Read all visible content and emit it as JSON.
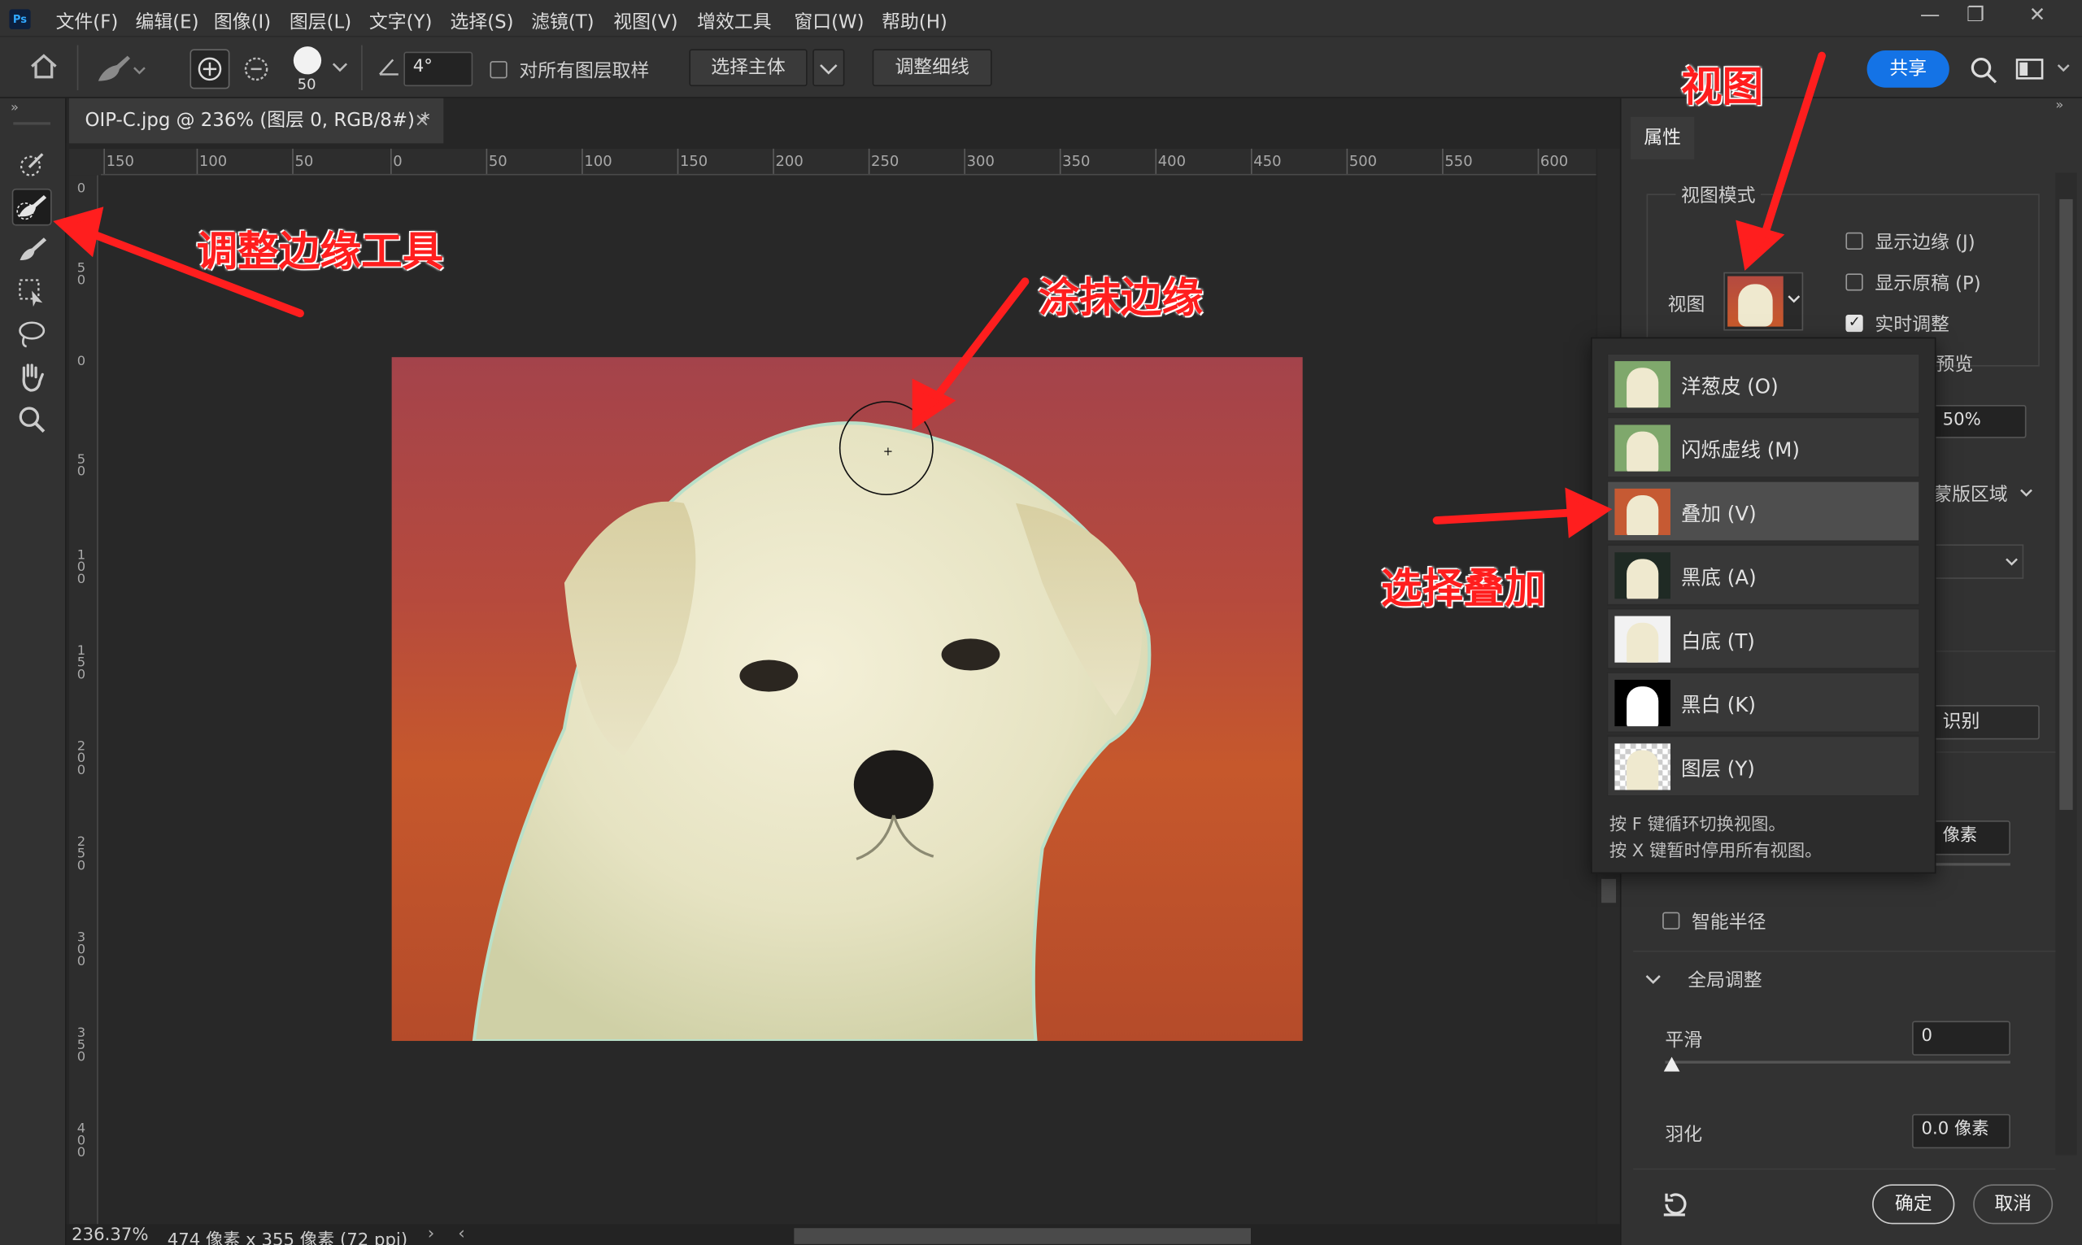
{
  "app": {
    "logo": "Ps"
  },
  "menu": [
    "文件(F)",
    "编辑(E)",
    "图像(I)",
    "图层(L)",
    "文字(Y)",
    "选择(S)",
    "滤镜(T)",
    "视图(V)",
    "增效工具",
    "窗口(W)",
    "帮助(H)"
  ],
  "window_controls": {
    "minimize": "—",
    "restore": "❐",
    "close": "✕"
  },
  "options": {
    "brush_size": "50",
    "angle": "4°",
    "sample_all_layers_label": "对所有图层取样",
    "select_subject_label": "选择主体",
    "refine_hair_label": "调整细线",
    "share_label": "共享"
  },
  "document": {
    "tab_title": "OIP-C.jpg @ 236% (图层 0, RGB/8#) *",
    "close_glyph": "×"
  },
  "ruler_h": [
    "150",
    "100",
    "50",
    "0",
    "50",
    "100",
    "150",
    "200",
    "250",
    "300",
    "350",
    "400",
    "450",
    "500",
    "550",
    "600"
  ],
  "ruler_v": [
    "0",
    "5 0",
    "0",
    "5 0",
    "1 0 0",
    "1 5 0",
    "2 0 0",
    "2 5 0",
    "3 0 0",
    "3 5 0",
    "4 0 0"
  ],
  "status": {
    "zoom": "236.37%",
    "dims": "474 像素 x 355 像素 (72 ppi)"
  },
  "properties": {
    "tab_label": "属性",
    "view_mode_label": "视图模式",
    "view_label": "视图",
    "show_edge": {
      "label": "显示边缘 (J)",
      "checked": false
    },
    "show_original": {
      "label": "显示原稿 (P)",
      "checked": false
    },
    "realtime": {
      "label": "实时调整",
      "checked": true
    },
    "preview_partial": "预览",
    "opacity_partial": "50%",
    "mask_partial": "蒙版区域",
    "detect_partial": "识别",
    "pixels_partial": "像素",
    "smart_radius_label": "智能半径",
    "global_adjust_label": "全局调整",
    "smooth_label": "平滑",
    "smooth_value": "0",
    "feather_label": "羽化",
    "feather_value": "0.0 像素",
    "ok_label": "确定",
    "cancel_label": "取消"
  },
  "view_dropdown": {
    "items": [
      {
        "label": "洋葱皮 (O)",
        "selected": false
      },
      {
        "label": "闪烁虚线 (M)",
        "selected": false
      },
      {
        "label": "叠加 (V)",
        "selected": true
      },
      {
        "label": "黑底 (A)",
        "selected": false
      },
      {
        "label": "白底 (T)",
        "selected": false
      },
      {
        "label": "黑白 (K)",
        "selected": false
      },
      {
        "label": "图层 (Y)",
        "selected": false
      }
    ],
    "hint1": "按 F 键循环切换视图。",
    "hint2": "按 X 键暂时停用所有视图。"
  },
  "annotations": {
    "view": "视图",
    "tool": "调整边缘工具",
    "smear": "涂抹边缘",
    "select_overlay": "选择叠加"
  },
  "colors": {
    "accent": "#1473e6",
    "annotation": "#ff1e1e",
    "overlay_red": "#b64a3d"
  }
}
